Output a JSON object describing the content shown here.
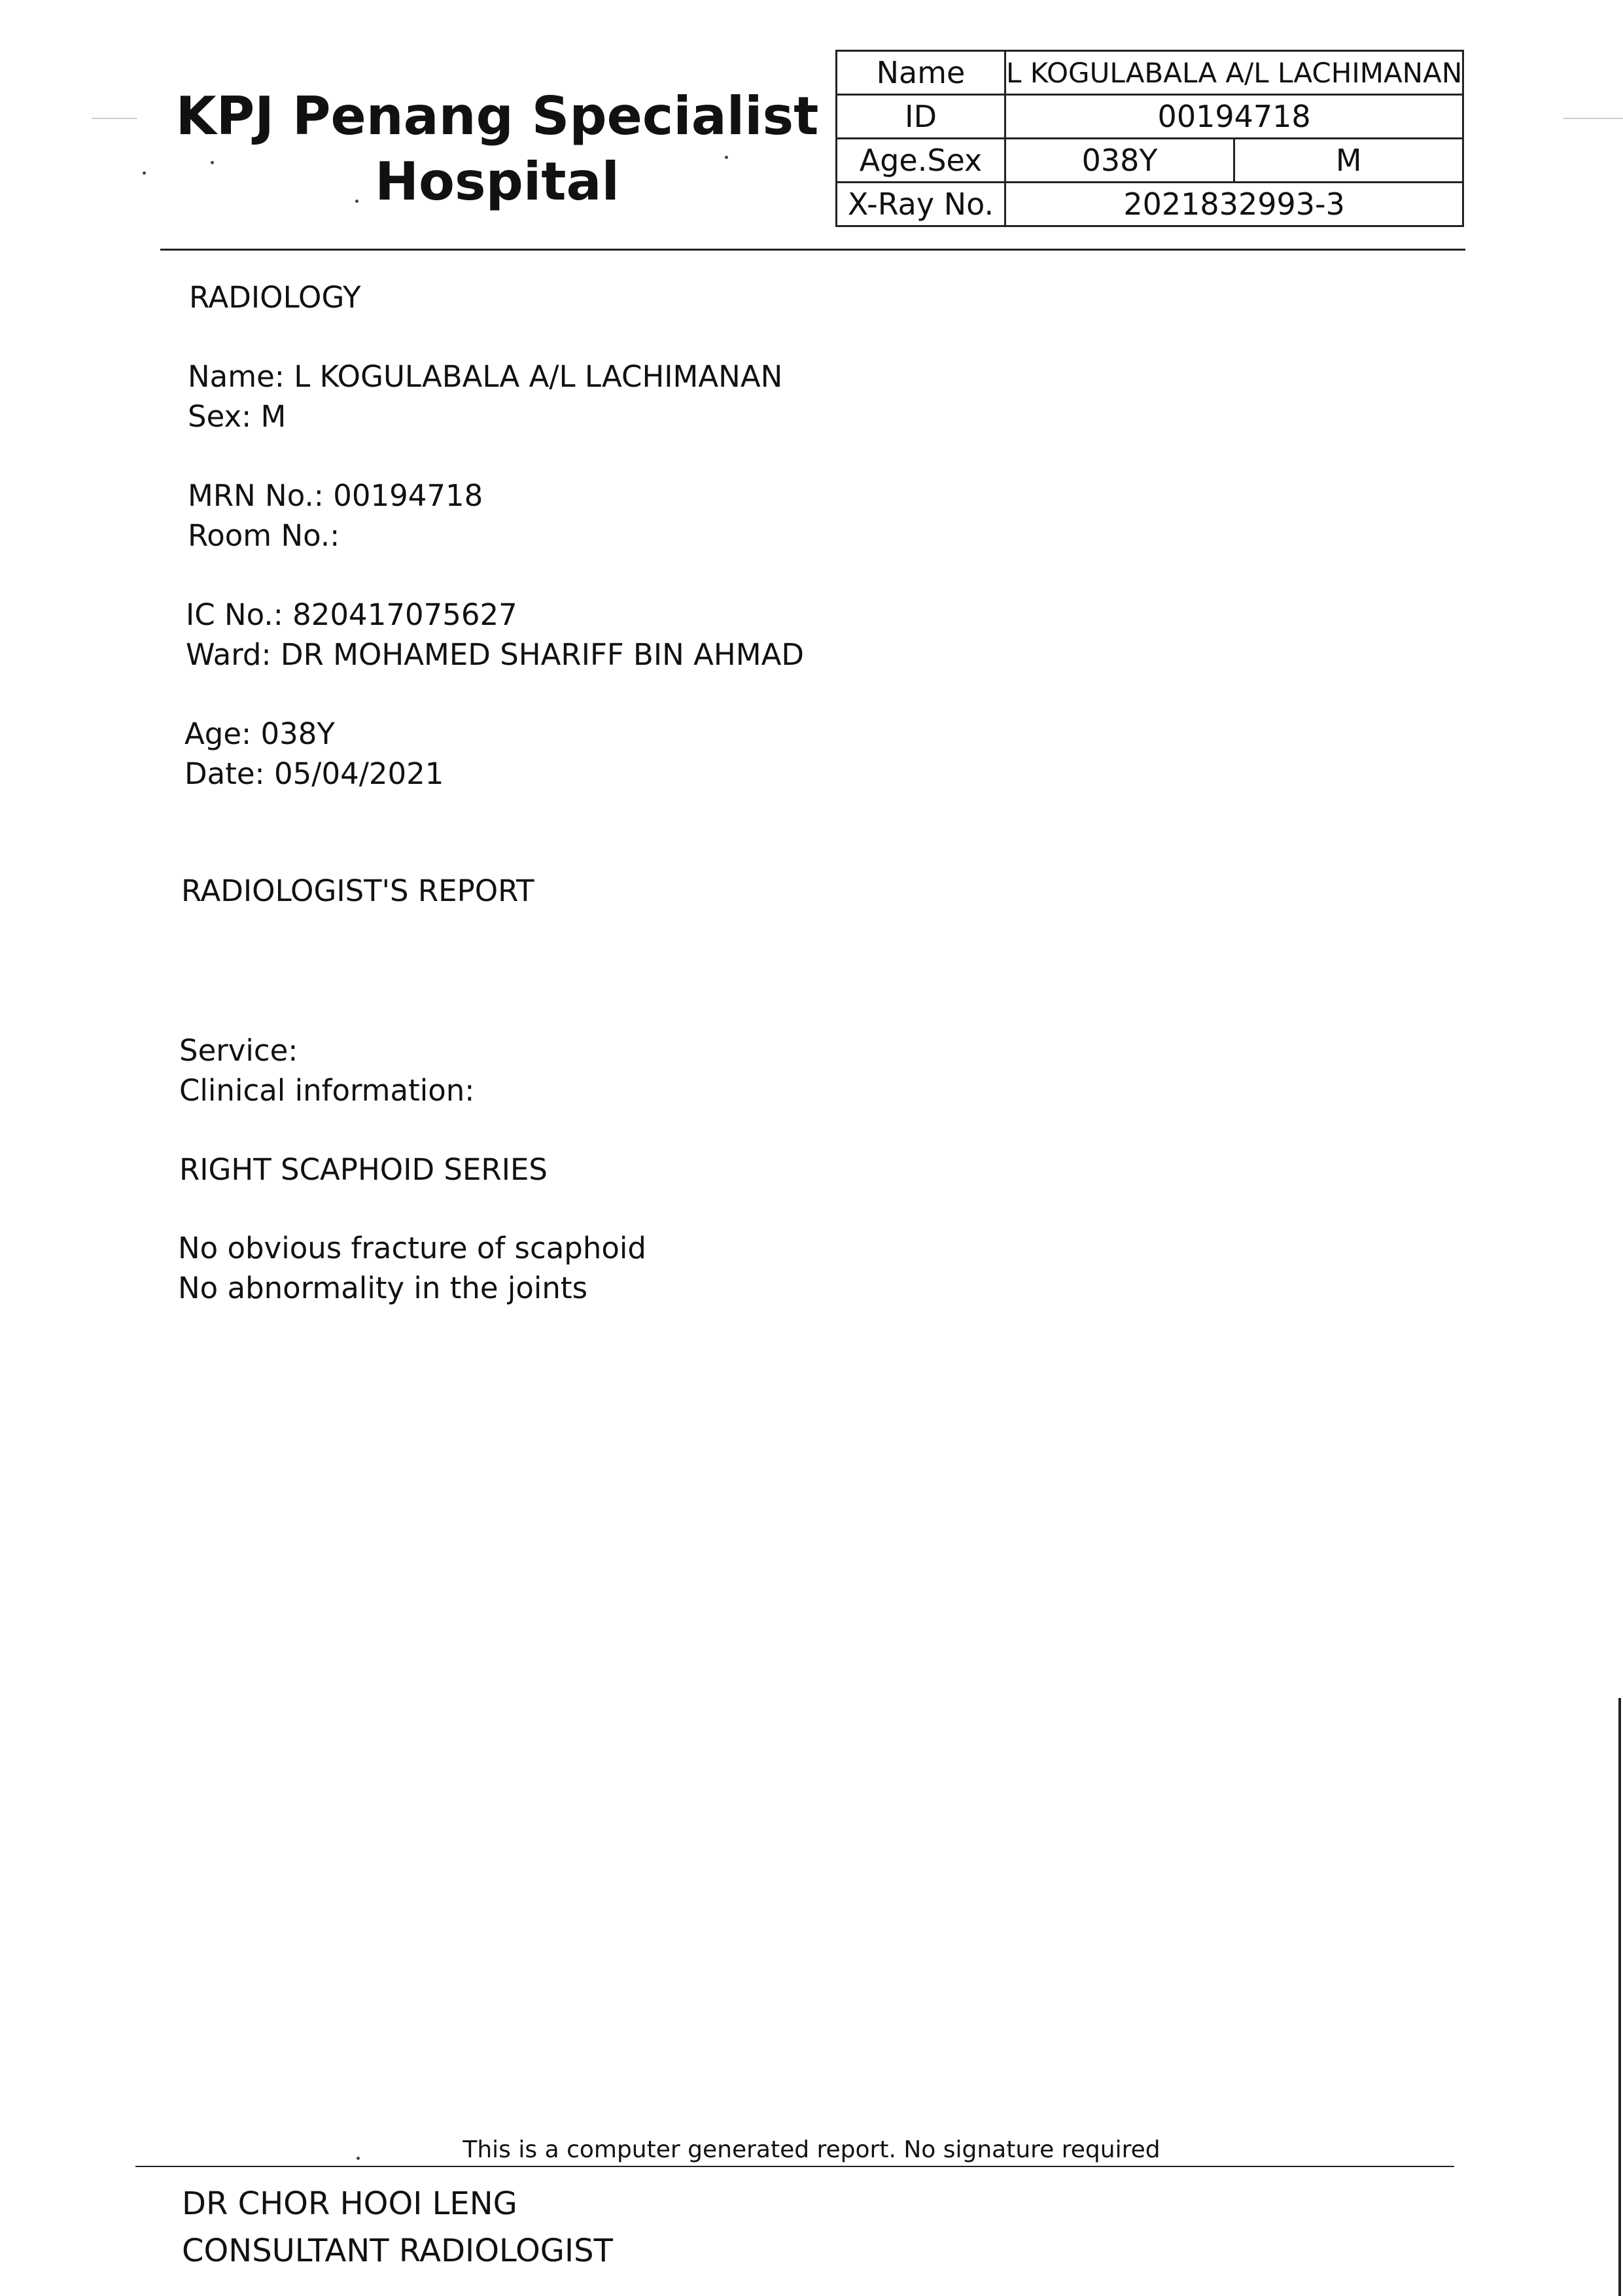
{
  "hospital": {
    "name_line1": "KPJ Penang Specialist",
    "name_line2": "Hospital"
  },
  "header_table": {
    "name_label": "Name",
    "name_value": "L KOGULABALA A/L LACHIMANAN",
    "id_label": "ID",
    "id_value": "00194718",
    "age_sex_label": "Age.Sex",
    "age_value": "038Y",
    "sex_value": "M",
    "xray_label": "X-Ray No.",
    "xray_value": "2021832993-3"
  },
  "report": {
    "department": "RADIOLOGY",
    "name_line": "Name: L KOGULABALA A/L LACHIMANAN",
    "sex_line": "Sex: M",
    "mrn_line": "MRN No.: 00194718",
    "room_line": "Room No.:",
    "ic_line": "IC No.: 820417075627",
    "ward_line": "Ward: DR MOHAMED SHARIFF BIN AHMAD",
    "age_line": "Age: 038Y",
    "date_line": "Date: 05/04/2021",
    "report_heading": "RADIOLOGIST'S REPORT",
    "service_line": "Service:",
    "clinical_line": "Clinical information:",
    "exam_title": "RIGHT SCAPHOID SERIES",
    "finding_1": "No obvious fracture of scaphoid",
    "finding_2": "No abnormality in the joints"
  },
  "footer": {
    "note": "This is a computer generated report. No signature required",
    "doctor_name": "DR CHOR HOOI LENG",
    "doctor_title": "CONSULTANT RADIOLOGIST"
  }
}
